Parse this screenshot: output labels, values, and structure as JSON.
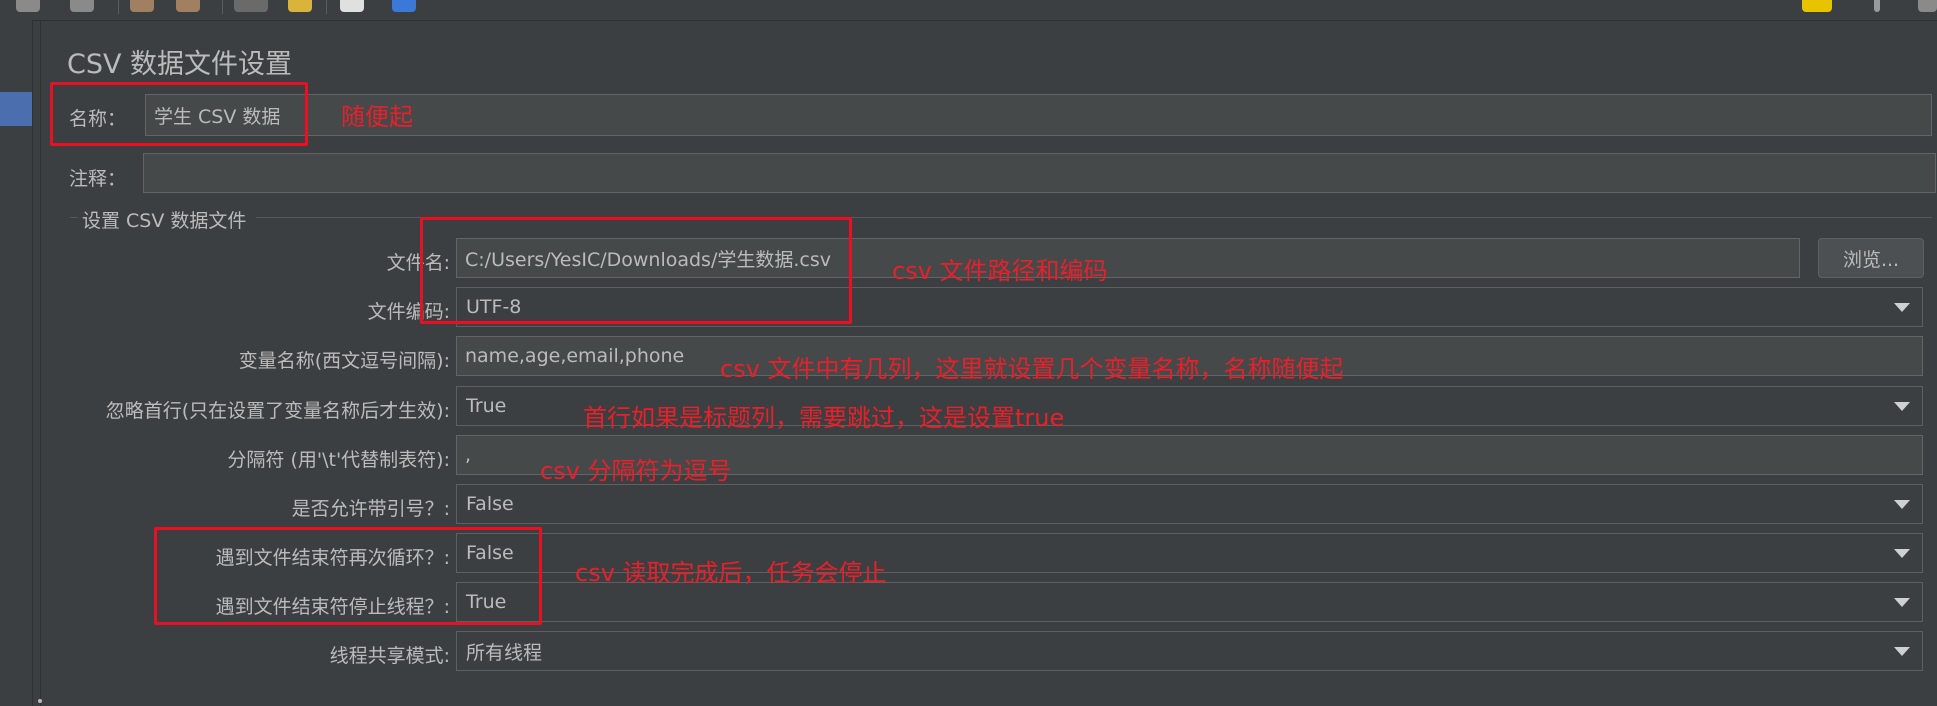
{
  "window": {
    "title": "CSV 数据文件设置"
  },
  "basic": {
    "name_label": "名称：",
    "name_value": "学生 CSV 数据",
    "comment_label": "注释：",
    "comment_value": ""
  },
  "group": {
    "title": "设置 CSV 数据文件",
    "rows": [
      {
        "label": "文件名:",
        "value": "C:/Users/YesIC/Downloads/学生数据.csv",
        "type": "text"
      },
      {
        "label": "文件编码:",
        "value": "UTF-8",
        "type": "combo"
      },
      {
        "label": "变量名称(西文逗号间隔):",
        "value": "name,age,email,phone",
        "type": "text"
      },
      {
        "label": "忽略首行(只在设置了变量名称后才生效):",
        "value": "True",
        "type": "combo"
      },
      {
        "label": "分隔符 (用'\\t'代替制表符):",
        "value": ",",
        "type": "text"
      },
      {
        "label": "是否允许带引号？:",
        "value": "False",
        "type": "combo"
      },
      {
        "label": "遇到文件结束符再次循环？:",
        "value": "False",
        "type": "combo"
      },
      {
        "label": "遇到文件结束符停止线程？:",
        "value": "True",
        "type": "combo"
      },
      {
        "label": "线程共享模式:",
        "value": "所有线程",
        "type": "combo"
      }
    ],
    "browse_label": "浏览..."
  },
  "annotations": {
    "name_note": "随便起",
    "file_note": "csv 文件路径和编码",
    "vars_note": "csv 文件中有几列，这里就设置几个变量名称，名称随便起",
    "ignore_note": "首行如果是标题列，需要跳过，这是设置true",
    "delim_note": "csv 分隔符为逗号",
    "eof_note": "csv 读取完成后，任务会停止"
  },
  "colors": {
    "background": "#3c3f41",
    "field": "#45494a",
    "annotation": "#e8202a",
    "selection": "#4b6eaf"
  }
}
